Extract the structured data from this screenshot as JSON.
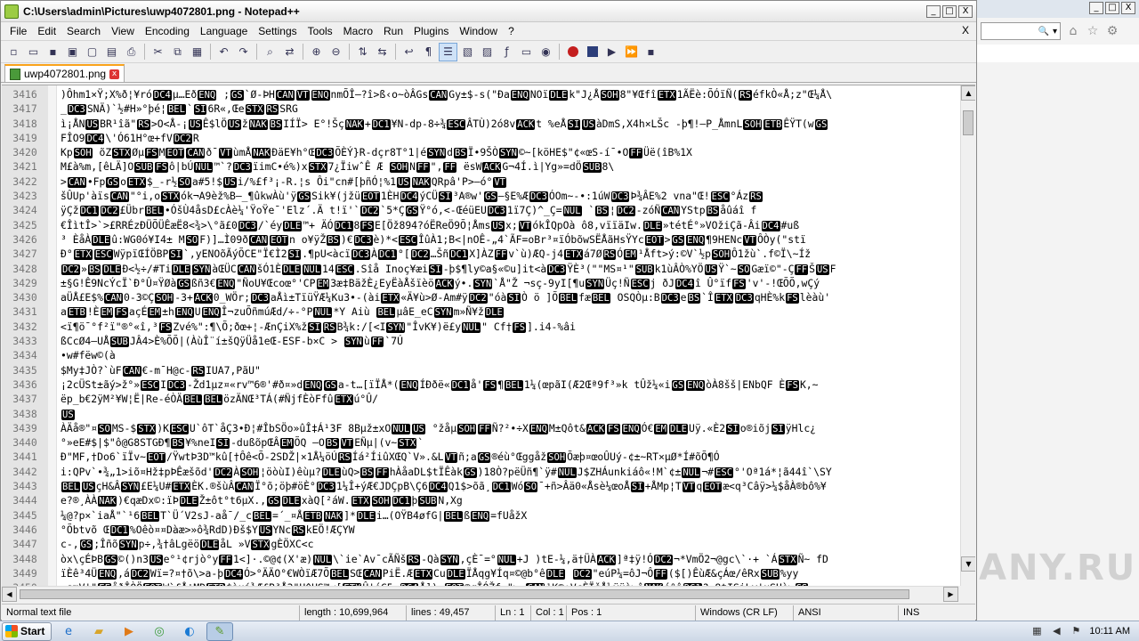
{
  "window": {
    "title": "C:\\Users\\admin\\Pictures\\uwp4072801.png - Notepad++",
    "minimize": "_",
    "maximize": "□",
    "close": "X"
  },
  "menu": [
    "File",
    "Edit",
    "Search",
    "View",
    "Encoding",
    "Language",
    "Settings",
    "Tools",
    "Macro",
    "Run",
    "Plugins",
    "Window",
    "?"
  ],
  "menu_close": "X",
  "toolbar_icons": [
    "new-file-icon",
    "open-file-icon",
    "save-icon",
    "save-all-icon",
    "close-icon",
    "close-all-icon",
    "print-icon",
    "cut-icon",
    "copy-icon",
    "paste-icon",
    "undo-icon",
    "redo-icon",
    "find-icon",
    "replace-icon",
    "zoom-in-icon",
    "zoom-out-icon",
    "sync-vertical-icon",
    "sync-horizontal-icon",
    "word-wrap-icon",
    "all-chars-icon",
    "indent-guide-icon",
    "udl-icon",
    "doc-map-icon",
    "function-list-icon",
    "folder-workspace-icon",
    "monitor-icon",
    "record-macro-icon",
    "stop-record-icon",
    "play-macro-icon",
    "play-multiple-icon",
    "save-macro-icon"
  ],
  "tab": {
    "label": "uwp4072801.png",
    "close": "x"
  },
  "editor": {
    "lines": [
      {
        "n": "3416",
        "t": ")Ôhm1×Ÿ;X%ð¦¥róDC4µ…EðENQ ;GS`Ø-ÞHCANVTENQnmÕÎ—?î>ß‹o~òÂGsCANGy±$-s(\"ÐaENQNOïDLEk\"J¿ÅSOH8\"¥ŒfîETX1ÃËè:ÕÓïÑ(RSéfkÒ«Å;z\"Œ¼Å\\"
      },
      {
        "n": "3417",
        "t": "_DC3SNÄ)`½#H»°þé¦BEL`SI6R«,ŒeSTXRSSRG"
      },
      {
        "n": "3418",
        "t": "ì¡ÅNUSBR¹îã\"RS>O<Å-¡USÊ$lÖUSžNAKBSIÍÏ> E°!ŠçNAK+DC1¥N-dp-8÷¾ESCÂTÙ)2ó8vACKt %eÅSIUSàDmS,X4h×LŠc -þ¶!—P_ÅmnLSOHETBÊŸT(wGS"
      },
      {
        "n": "3419",
        "t": "FÎO9DC4\\'Ó61H°œ+fVDC2R"
      },
      {
        "n": "3420",
        "t": "KpSOH õZSTXØµFSMEOTCANð¯VTùmÅNAKÐäE¥h°ŒDC3ÕÈÝ}R-dçr8T°1|éSYNdBSÏ•9ŠÒSYN©~[köHE$\"¢«œS-í¯•OFFÜë(îB%1X"
      },
      {
        "n": "3421",
        "t": "M£à%m,[êLÄ]OSUBFSô|bÚNUL™`?DC3ïimC•é%)xSTX7¿ÏiwˆÊ Æ   SOHNFF\",FF ësWACKG¬4Í.ì|Yg»=dÖSUB8\\"
      },
      {
        "n": "3422",
        "t": ">CAN•FpGSoETX$_-r½SOa#5!$USi/%£f³¡-R.¦s Ôi\"cn#[þñÓ¦%1USNAKQRpâ'P>—ó°VT"
      },
      {
        "n": "3423",
        "t": "šÛUp'àïsCAN\"°i,oSTXók¬A9èž%B—_¶ûkwÀù'ÿGSSik¥(jžüEOT1ÈHDC4ýCÜSI³A®w'GS—§E%ÆDC3ÓOm~-•:1úWDC3Þ¾ÂE%2 vna\"Œ!ESC°ÁzRS"
      },
      {
        "n": "3424",
        "t": "ÿÇžDC1DC2£ÜbrBEL•ÓšÙ4åsD£cÀè¼'ŸoŸe¯'Elz´.Ä t!ï'`DC2`5*ÇGSŸ°ó,<-ŒéüEUDC31ï7Ç)^_Ç=NUL  `BS¦DC2-zóÑCANYStpBSåûáî f"
      },
      {
        "n": "3425",
        "t": "€ÎìtÎ>`>£RRÉzÐÜÕÜÊæË8<¾>\\°ã£0DC3/`éyDLE™+ ÄÓDC18FSE[Öž894?óËReÖ9Õ¦ÅmsUSx;VTókÎQpOà ô8,vïïäIw.DLE»tétÉ°»VOžiÇã-ÂiDC4#uß"
      },
      {
        "n": "3426",
        "t": "³ ÈåÀDLEû:WG0ó¥I4± MSOF)]…Ì09ðCANEOTn o¥ÿŽBS)€DC3è)*<ESCÎûÀ1;B<|nOÊ-„4`ÃF=oBr³¤ïÓbõwSËÅãHsŸYcEOT>GSENQ¶9HENcVTÔÒy(\"stï"
      },
      {
        "n": "3427",
        "t": "Ð°ETXESCWÿpïŒÍÖBPSI`,yENOõÃýÕCE\"Ï€Ì2SI.¶pU<àcïDC3ÀDC1°[DC2…ŠñDC1X]ÀZFFv`ù)ÆQ-j4ETXá7ØRSÓEM¹Åft>ý:©V`½pSOHÔ1žù`.f©Ï\\~Íž"
      },
      {
        "n": "3428",
        "t": "DC2»BSDLEÐ<½÷/#TiDLESYNàŒÜCCANšÓ1ÈDLENUL14ESC.Sîå Inoç¥æiSI-þ$¶ly©a§«©u]it<àDC3ŸÈ³(\"\"MS¤¹\"SUBk1ùÂÒ%YÖUSŸ`~SOGæï©\"-ÇFFŠUSF"
      },
      {
        "n": "3429",
        "t": "±§G!Ê9NcÝcÏ`Ð°Û¤ŸØàGSßñ3€ENQ\"ÑoU¥Œcoœ°'CPEM3æ‡BäžÈ¿EyËàÅšïèöACKý•.SYN`Å\"Ž ¬sç-9yI[¶uSYNÜç!ÑESCj   ðJDC4î Û°ïfFS'v'-!ŒÕÕ,wÇý"
      },
      {
        "n": "3430",
        "t": "aÜÅ£E$%CAN0-3©ÇSOH-3+ACK0_WÖr;DC3aÅì±TïüŸÆ¼Ku3•-(àiETX«Ä¥ù>Ø-Am#ÿDC2\"óàSIÒ ö ]ÕBELfæBEL OSQÒµ:BDC3eBS`ÎETXDC3qHÈ%kFSlèàù'"
      },
      {
        "n": "3431",
        "t": "aETB!ÈEMFSaçÉEM±hENQUENQÎ¬zuÕñmúÆd/÷-°PNUL*Y  Aiù BELµâE_eCSYNm»Ñ¥žDLE"
      },
      {
        "n": "3432",
        "t": "<ï¶ö¯°f²ï\"®°«î,³FSZvé%\":¶\\Õ;ðœ+¦-ÆnÇiX%žSIRSB¾k:/[<ISYN\"ÎvK¥)ë£yNUL\"  Cf†FS].i4-%âi"
      },
      {
        "n": "3433",
        "t": "ßCcØ4—UÅSUBJÂ4>È%ÕÕ|(ÀùÎ¨í±šQÿÜå1eŒ-ESF-b×C   >  SYNùFF`7Ú"
      },
      {
        "n": "3434",
        "t": "•w#fëw©(à"
      },
      {
        "n": "3435",
        "t": "$My‡JÒ?`ùFCAN€-m¯H@c-RSIUA7,PãU\""
      },
      {
        "n": "3436",
        "t": "¡2cÜSt±ãý>ž°»ESCIDC3-Žd1µz¤«rv™6®'#ð¤»dENQGSa-t…[ïÏÅ*(ENQÍÐðë«DC1å'FS¶BEL1¼(œpãI(Æ2Œª9f³»k  tÛž¼«iGSENQòÀ8šš|ENbQF ÈFSK,~"
      },
      {
        "n": "3437",
        "t": "ëp_b€2ÿM²¥W¦Ë|Re-éÒÄBELBELözÄNŒ³TÁ(#ÑjfÈòFfûETXú°Û/"
      },
      {
        "n": "3438",
        "t": "US"
      },
      {
        "n": "3439",
        "t": "ÀÄå®\"¤SOMS-$STX)KESCU`ôT`åÇ3•Ð¦#ÎbSÖo»ûÎ‡Á¹3F  8Bµž±xONULUS   °žåµSOHFFÑ?²•÷XENQM±Qôt&ACKFSENQÓ€EMDLEUÿ.«È2SIo®iõjSIÿHlc¿"
      },
      {
        "n": "3440",
        "t": "°»eE#$|$\"ô@G8STGÐ¶BS¥%neISI-dußõpŒÂEMÕQ —OBSVTEÑµ|(v~STX`"
      },
      {
        "n": "3441",
        "t": "Ð\"MF,†Do6`ïÏv~EOT/ŸwtÞ3D™kû[†Ôê<Õ-2SDŽ|×1Å¼öÚRSÍá²ÍiûXŒQ`V».&LVTñ;aGS®éù°ŒggåžSOHÕæþ¤œoÛUý-¢±~RT×µØ*Í#õÕ¶Ó"
      },
      {
        "n": "3442",
        "t": "i:QPv`•¾„1>iõ¤Hž‡pÞÊæšõd'DC2ÀSOH¦öòùI)êùµ?DLEùQ>BSFFhÀåaDL$tÏÊàkGS)18Ò?pëÜñ¶`ÿ#NULJ$ZHÁunkiáô«!M`¢±NUL¬#ESC°'Oª1á*¦ã44î`\\SY"
      },
      {
        "n": "3443",
        "t": "BELUSçH&ÂSYN£E¼U#ETXÈK.®šùÂCANÏ°õ;öþ#öÈ°DC31¼Î+ýÆ€JDÇpB\\Ç6DC4Q1$>õã¸DC1WóSO¯+ñ>Âä0«Åsè¼œoÅSI+ÅMp¦TVTqEOTæ<q³Câÿ>¼$åÀ®bô%¥"
      },
      {
        "n": "3444",
        "t": "e?®¸ÀÀNAK)€qæDx©:ïÞDLEŽ±ôt°t6µX.,GSDLExàQ[²áW.ETXSOHDC1þSUBN,Xg"
      },
      {
        "n": "3445",
        "t": "¼@?p×`iaÅ\"`¹6BELT`Ü´V2sJ-aå¯/_cBEL=´_¤ÅETBNAK]*DLEi…(OŸB4øfG|BELßENQ=fUåžX"
      },
      {
        "n": "3446",
        "t": "°Õbtvõ ŒDC1%Oêò¤¤Dàæ>»ô¾RdD)Ðš$YUSYNcRSkEÖ!ÆÇYW"
      },
      {
        "n": "3447",
        "t": "c-,GS;ÎñõSYNp÷,¾†âLgëöDLEåL   »VSTXgÈÖXC<c"
      },
      {
        "n": "3448",
        "t": "òx\\çÉÞBGS©()n3USe°¹¢rjò°yFF1<]·.©@¢(X'æ)NUL\\`ie`Av¯cÃÑšRS-QàSYN,çÈ¯=°NUL+J )tE-¼,ä†ÜÀACK]ª‡ÿ!ÓDC2¬*VmÖ2¬@gc\\`·+  `ÁSTXÑ~ fD"
      },
      {
        "n": "3449",
        "t": "ïÈê³4ÜENQ,áDC2Wï=?¤†õ\\>a-þDC4Ó>°ÄÄO°€WÒïÆ7ÕBELSŒCANPiË.ÆETXCuDLEÏÅqg¥Íq¤©@b°êDLE    DC2\"eúP¼=ôJ¬ÔFF($[)ÊùÆ&çÁœ/êRxSUB%yy"
      },
      {
        "n": "3450",
        "t": "·smV'\"FFåðÎÒÖEOTW`£Å¦MDETB$àuí¾Æ£B³Å3\"H^HS™<[ETXÛ†éÇ5 DC4Å])¤EOT©øÎÓŽf-\">•CAN¹K®;VcÈÏšÅ¼ÿüà>ôNAKé°âDC1?,8tISiLy'uSUò>GS"
      }
    ]
  },
  "status": {
    "file_type": "Normal text file",
    "length": "length : 10,699,964",
    "lines": "lines : 49,457",
    "ln": "Ln : 1",
    "col": "Col : 1",
    "pos": "Pos : 1",
    "eol": "Windows (CR LF)",
    "encoding": "ANSI",
    "ins": "INS"
  },
  "browser": {
    "minimize": "_",
    "maximize": "□",
    "close": "X",
    "search_glyph": "🔍",
    "dropdown_glyph": "▾",
    "home_icon": "⌂",
    "star_icon": "☆",
    "gear_icon": "⚙"
  },
  "watermark": "ANY.RUN",
  "taskbar": {
    "start_label": "Start",
    "time": "10:11 AM",
    "apps": [
      "ie-icon",
      "explorer-icon",
      "media-player-icon",
      "chrome-icon",
      "edge-icon",
      "notepadpp-icon"
    ]
  },
  "colors": {
    "control_char_bg": "#000000",
    "control_char_fg": "#ffffff",
    "tab_accent": "#f9a31b"
  }
}
